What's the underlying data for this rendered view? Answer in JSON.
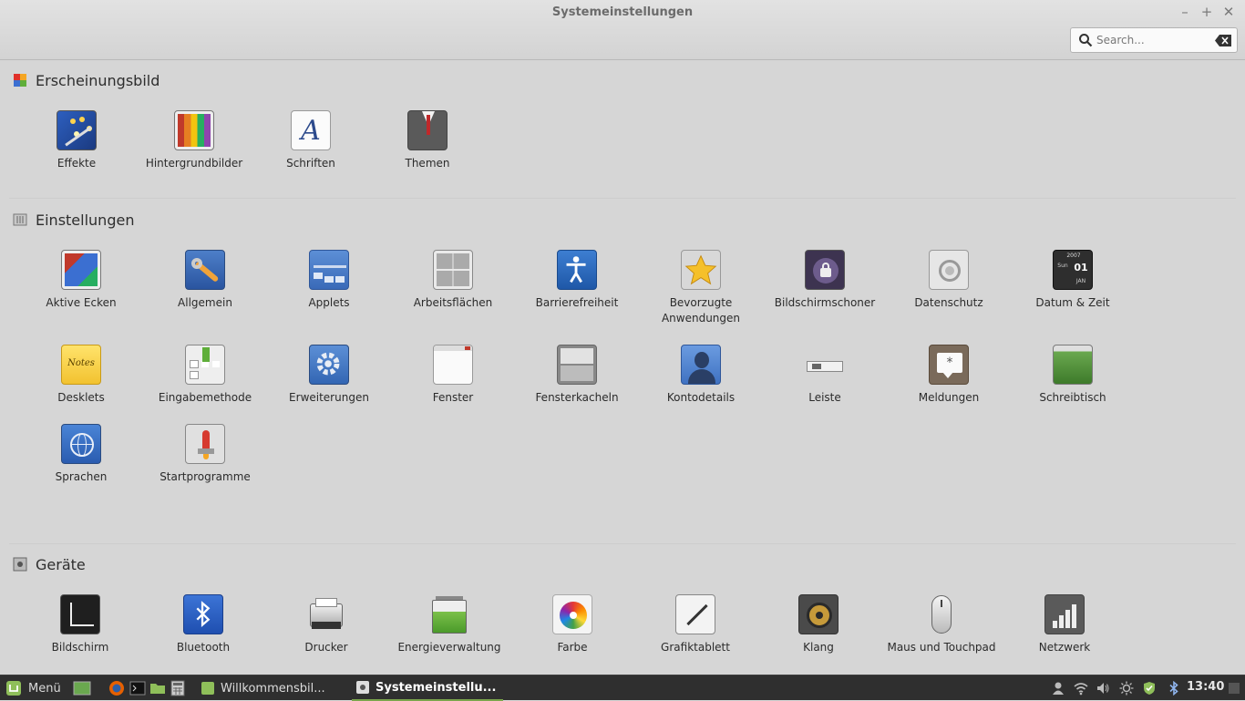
{
  "window": {
    "title": "Systemeinstellungen",
    "minimize": "–",
    "maximize": "+",
    "close": "✕"
  },
  "search": {
    "placeholder": "Search..."
  },
  "sections": [
    {
      "title": "Erscheinungsbild",
      "items": [
        "Effekte",
        "Hintergrundbilder",
        "Schriften",
        "Themen"
      ]
    },
    {
      "title": "Einstellungen",
      "items": [
        "Aktive Ecken",
        "Allgemein",
        "Applets",
        "Arbeitsflächen",
        "Barrierefreiheit",
        "Bevorzugte Anwendungen",
        "Bildschirmschoner",
        "Datenschutz",
        "Datum & Zeit",
        "Desklets",
        "Eingabemethode",
        "Erweiterungen",
        "Fenster",
        "Fensterkacheln",
        "Kontodetails",
        "Leiste",
        "Meldungen",
        "Schreibtisch",
        "Sprachen",
        "Startprogramme"
      ]
    },
    {
      "title": "Geräte",
      "items": [
        "Bildschirm",
        "Bluetooth",
        "Drucker",
        "Energieverwaltung",
        "Farbe",
        "Grafiktablett",
        "Klang",
        "Maus und Touchpad",
        "Netzwerk"
      ]
    }
  ],
  "icon_text": {
    "schriften": "A",
    "datum_year": "2007",
    "datum_day": "01",
    "datum_wd": "Sun",
    "datum_month": "JAN",
    "desklets": "Notes"
  },
  "panel": {
    "menu_label": "Menü",
    "tasks": [
      "Willkommensbil...",
      "Systemeinstellu..."
    ],
    "clock": "13:40"
  },
  "colors": {
    "panel_bg": "#2f2f2f",
    "accent": "#7aa54c",
    "window_bg": "#d6d6d6"
  }
}
